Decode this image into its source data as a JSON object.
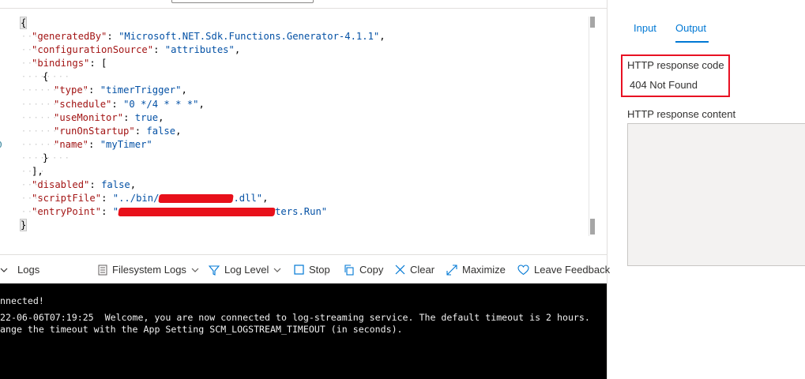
{
  "editor": {
    "lines": [
      {
        "num": "",
        "parts": [
          [
            "{",
            "b"
          ]
        ]
      },
      {
        "num": "",
        "parts": [
          [
            "\"generatedBy\"",
            "k"
          ],
          [
            ": ",
            "b"
          ],
          [
            "\"Microsoft.NET.Sdk.Functions.Generator-4.1.1\"",
            "s"
          ],
          [
            ",",
            "b"
          ]
        ]
      },
      {
        "num": "",
        "parts": [
          [
            "\"configurationSource\"",
            "k"
          ],
          [
            ": ",
            "b"
          ],
          [
            "\"attributes\"",
            "s"
          ],
          [
            ",",
            "b"
          ]
        ]
      },
      {
        "num": "",
        "parts": [
          [
            "\"bindings\"",
            "k"
          ],
          [
            ": [",
            "b"
          ]
        ]
      },
      {
        "num": "",
        "parts": [
          [
            "{",
            "b"
          ]
        ]
      },
      {
        "num": "",
        "parts": [
          [
            "\"type\"",
            "k"
          ],
          [
            ": ",
            "b"
          ],
          [
            "\"timerTrigger\"",
            "s"
          ],
          [
            ",",
            "b"
          ]
        ]
      },
      {
        "num": "",
        "parts": [
          [
            "\"schedule\"",
            "k"
          ],
          [
            ": ",
            "b"
          ],
          [
            "\"0 */4 * * *\"",
            "s"
          ],
          [
            ",",
            "b"
          ]
        ]
      },
      {
        "num": "",
        "parts": [
          [
            "\"useMonitor\"",
            "k"
          ],
          [
            ": ",
            "b"
          ],
          [
            "true",
            "v"
          ],
          [
            ",",
            "b"
          ]
        ]
      },
      {
        "num": "",
        "parts": [
          [
            "\"runOnStartup\"",
            "k"
          ],
          [
            ": ",
            "b"
          ],
          [
            "false",
            "v"
          ],
          [
            ",",
            "b"
          ]
        ]
      },
      {
        "num": "0",
        "parts": [
          [
            "\"name\"",
            "k"
          ],
          [
            ": ",
            "b"
          ],
          [
            "\"myTimer\"",
            "s"
          ]
        ]
      },
      {
        "num": "",
        "parts": [
          [
            "}",
            "b"
          ]
        ]
      },
      {
        "num": "",
        "parts": [
          [
            "],",
            "b"
          ]
        ]
      },
      {
        "num": "",
        "parts": [
          [
            "\"disabled\"",
            "k"
          ],
          [
            ": ",
            "b"
          ],
          [
            "false",
            "v"
          ],
          [
            ",",
            "b"
          ]
        ]
      },
      {
        "num": "",
        "parts": [
          [
            "\"scriptFile\"",
            "k"
          ],
          [
            ": ",
            "b"
          ],
          [
            "\"../bin/",
            "s"
          ],
          [
            "##REDACT##",
            "r"
          ],
          [
            ".dll\"",
            "s"
          ],
          [
            ",",
            "b"
          ]
        ]
      },
      {
        "num": "",
        "parts": [
          [
            "\"entryPoint\"",
            "k"
          ],
          [
            ": ",
            "b"
          ],
          [
            "\"",
            "s"
          ],
          [
            "##REDACT##",
            "r"
          ],
          [
            "ters.Run\"",
            "s"
          ]
        ]
      },
      {
        "num": "",
        "parts": [
          [
            "}",
            "b"
          ]
        ]
      }
    ]
  },
  "toolbar": {
    "logs": "Logs",
    "filesystem_logs": "Filesystem Logs",
    "log_level": "Log Level",
    "stop": "Stop",
    "copy": "Copy",
    "clear": "Clear",
    "maximize": "Maximize",
    "leave_feedback": "Leave Feedback"
  },
  "terminal": {
    "lines": [
      "nnected!",
      "22-06-06T07:19:25  Welcome, you are now connected to log-streaming service. The default timeout is 2 hours.",
      "ange the timeout with the App Setting SCM_LOGSTREAM_TIMEOUT (in seconds)."
    ]
  },
  "panel": {
    "tab_input": "Input",
    "tab_output": "Output",
    "response_code_label": "HTTP response code",
    "response_code_value": "404 Not Found",
    "response_content_label": "HTTP response content"
  },
  "colors": {
    "accent": "#0078d4",
    "highlight_box": "#e81123",
    "json_key": "#a31515",
    "json_value": "#0451a5",
    "terminal_bg": "#000000"
  }
}
